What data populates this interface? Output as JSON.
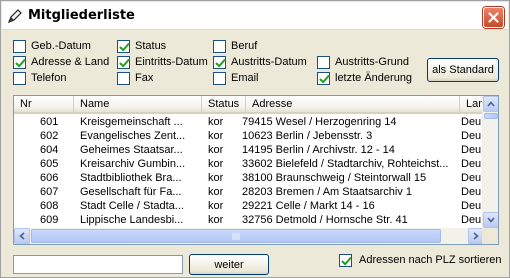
{
  "window": {
    "title": "Mitgliederliste",
    "close_label": "close"
  },
  "checkboxes": [
    {
      "label": "Geb.-Datum",
      "checked": false
    },
    {
      "label": "Status",
      "checked": true
    },
    {
      "label": "Beruf",
      "checked": false
    },
    {
      "label": "Adresse & Land",
      "checked": true
    },
    {
      "label": "Eintritts-Datum",
      "checked": true
    },
    {
      "label": "Austritts-Datum",
      "checked": true
    },
    {
      "label": "Austritts-Grund",
      "checked": false
    },
    {
      "label": "Telefon",
      "checked": false
    },
    {
      "label": "Fax",
      "checked": false
    },
    {
      "label": "Email",
      "checked": false
    },
    {
      "label": "letzte Änderung",
      "checked": true
    }
  ],
  "buttons": {
    "als_standard": "als Standard",
    "weiter": "weiter"
  },
  "table": {
    "columns": [
      "Nr",
      "Name",
      "Status",
      "Adresse",
      "Land"
    ],
    "rows": [
      [
        "601",
        "Kreisgemeinschaft ...",
        "kor",
        "79415 Wesel / Herzogenring 14",
        "Deu"
      ],
      [
        "602",
        "Evangelisches Zent...",
        "kor",
        "10623 Berlin / Jebensstr. 3",
        "Deu"
      ],
      [
        "604",
        "Geheimes Staatsar...",
        "kor",
        "14195 Berlin / Archivstr. 12 - 14",
        "Deu"
      ],
      [
        "605",
        "Kreisarchiv Gumbin...",
        "kor",
        "33602 Bielefeld / Stadtarchiv, Rohteichst...",
        "Deu"
      ],
      [
        "606",
        "Stadtbibliothek Bra...",
        "kor",
        "38100 Braunschweig / Steintorwall 15",
        "Deu"
      ],
      [
        "607",
        "Gesellschaft für Fa...",
        "kor",
        "28203 Bremen / Am Staatsarchiv 1",
        "Deu"
      ],
      [
        "608",
        "Stadt Celle / Stadta...",
        "kor",
        "29221 Celle / Markt 14 - 16",
        "Deu"
      ],
      [
        "609",
        "Lippische Landesbi...",
        "kor",
        "32756 Detmold / Hornsche Str. 41",
        "Deu"
      ]
    ]
  },
  "search": {
    "value": ""
  },
  "plz_sort": {
    "label": "Adressen nach PLZ sortieren",
    "checked": true
  }
}
